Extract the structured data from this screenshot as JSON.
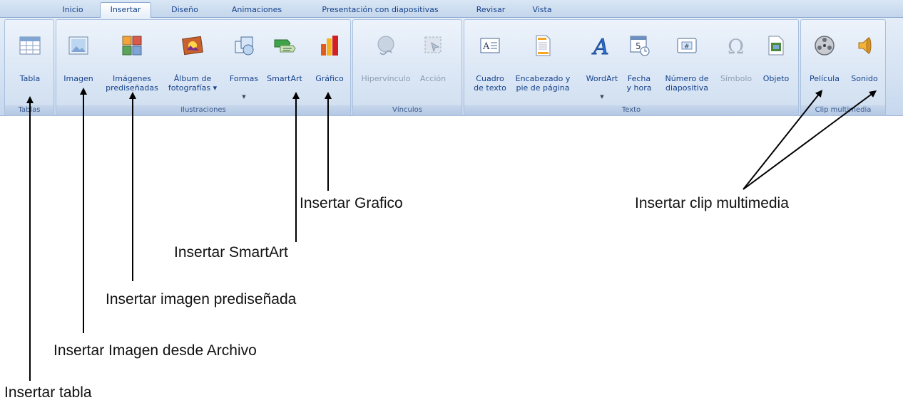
{
  "tabs": [
    "Inicio",
    "Insertar",
    "Diseño",
    "Animaciones",
    "Presentación con diapositivas",
    "Revisar",
    "Vista"
  ],
  "active_tab": "Insertar",
  "groups": {
    "tablas": "Tablas",
    "ilustraciones": "Ilustraciones",
    "vinculos": "Vínculos",
    "texto": "Texto",
    "clip": "Clip multimedia"
  },
  "commands": {
    "tabla": "Tabla",
    "imagen": "Imagen",
    "imagenes_prediseñadas": "Imágenes\nprediseñadas",
    "album": "Álbum de\nfotografías ▾",
    "formas": "Formas",
    "smartart": "SmartArt",
    "grafico": "Gráfico",
    "hipervinculo": "Hipervínculo",
    "accion": "Acción",
    "cuadro_texto": "Cuadro\nde texto",
    "encabezado": "Encabezado y\npie de página",
    "wordart": "WordArt",
    "fecha_hora": "Fecha\ny hora",
    "numero_diapositiva": "Número de\ndiapositiva",
    "simbolo": "Símbolo",
    "objeto": "Objeto",
    "pelicula": "Película",
    "sonido": "Sonido"
  },
  "annotations": {
    "tabla": "Insertar tabla",
    "imagen": "Insertar Imagen desde Archivo",
    "prediseñada": "Insertar imagen prediseñada",
    "smartart": "Insertar SmartArt",
    "grafico": "Insertar Grafico",
    "clip": "Insertar clip multimedia"
  }
}
